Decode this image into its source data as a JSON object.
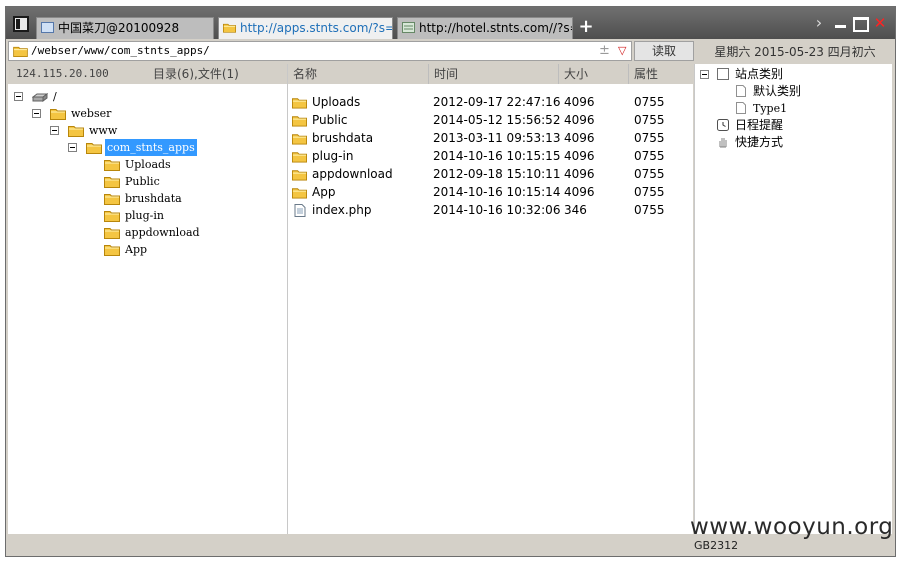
{
  "tabs": [
    {
      "label": "中国菜刀@20100928"
    },
    {
      "label": "http://apps.stnts.com/?s=/ab..."
    },
    {
      "label": "http://hotel.stnts.com//?s=/a..."
    }
  ],
  "new_tab_label": "+",
  "window_controls": {
    "next": "›",
    "close": "✕"
  },
  "address": {
    "path": "/webser/www/com_stnts_apps/",
    "plus": "±",
    "dropdown": "▽"
  },
  "read_button": "读取",
  "date": "星期六 2015-05-23 四月初六",
  "left_panel": {
    "ip": "124.115.20.100",
    "dir_count": "目录(6),文件(1)",
    "tree": [
      {
        "label": "/",
        "icon": "drive-icon"
      },
      {
        "label": "webser",
        "icon": "folder-icon"
      },
      {
        "label": "www",
        "icon": "folder-icon"
      },
      {
        "label": "com_stnts_apps",
        "icon": "folder-icon",
        "selected": true
      },
      {
        "label": "Uploads",
        "icon": "folder-icon"
      },
      {
        "label": "Public",
        "icon": "folder-icon"
      },
      {
        "label": "brushdata",
        "icon": "folder-icon"
      },
      {
        "label": "plug-in",
        "icon": "folder-icon"
      },
      {
        "label": "appdownload",
        "icon": "folder-icon"
      },
      {
        "label": "App",
        "icon": "folder-icon"
      }
    ]
  },
  "file_list": {
    "headers": {
      "name": "名称",
      "time": "时间",
      "size": "大小",
      "attr": "属性"
    },
    "rows": [
      {
        "name": "Uploads",
        "time": "2012-09-17 22:47:16",
        "size": "4096",
        "attr": "0755",
        "icon": "folder-icon"
      },
      {
        "name": "Public",
        "time": "2014-05-12 15:56:52",
        "size": "4096",
        "attr": "0755",
        "icon": "folder-icon"
      },
      {
        "name": "brushdata",
        "time": "2013-03-11 09:53:13",
        "size": "4096",
        "attr": "0755",
        "icon": "folder-icon"
      },
      {
        "name": "plug-in",
        "time": "2014-10-16 10:15:15",
        "size": "4096",
        "attr": "0755",
        "icon": "folder-icon"
      },
      {
        "name": "appdownload",
        "time": "2012-09-18 15:10:11",
        "size": "4096",
        "attr": "0755",
        "icon": "folder-icon"
      },
      {
        "name": "App",
        "time": "2014-10-16 10:15:14",
        "size": "4096",
        "attr": "0755",
        "icon": "folder-icon"
      },
      {
        "name": "index.php",
        "time": "2014-10-16 10:32:06",
        "size": "346",
        "attr": "0755",
        "icon": "file-icon"
      }
    ]
  },
  "right_panel": {
    "site_category": "站点类别",
    "default_category": "默认类别",
    "type1": "Type1",
    "schedule": "日程提醒",
    "shortcut": "快捷方式"
  },
  "status": {
    "encoding": "GB2312"
  },
  "watermark": "www.wooyun.org",
  "colors": {
    "accent": "#3399ff",
    "folder": "#f4c542",
    "close": "#ff2222"
  }
}
